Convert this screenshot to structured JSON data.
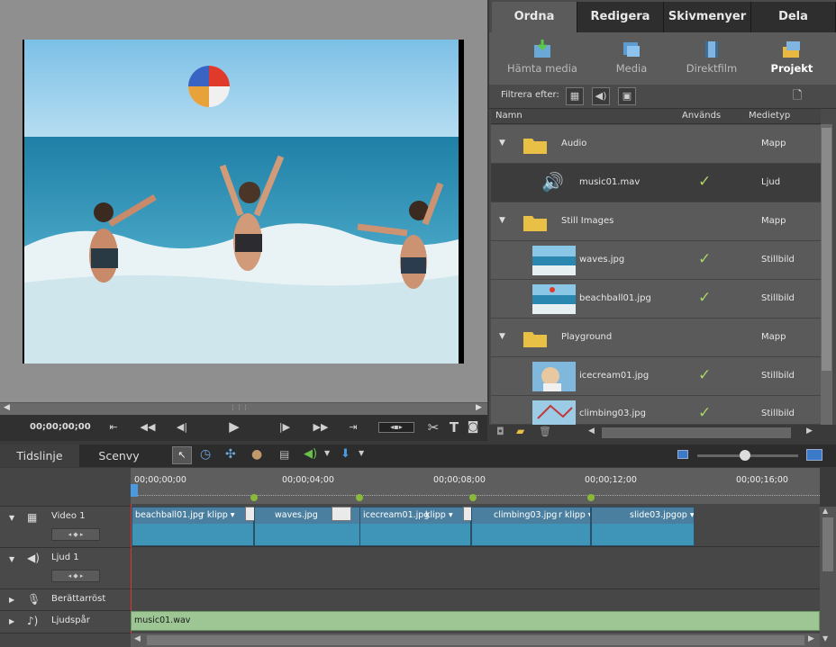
{
  "monitor": {
    "timecode": "00;00;00;00",
    "scroll_grip": "⋮⋮⋮"
  },
  "tabs": [
    "Ordna",
    "Redigera",
    "Skivmenyer",
    "Dela"
  ],
  "subtabs": [
    "Hämta media",
    "Media",
    "Direktfilm",
    "Projekt"
  ],
  "filter_label": "Filtrera efter:",
  "columns": {
    "name": "Namn",
    "used": "Används",
    "type": "Medietyp"
  },
  "rows": [
    {
      "name": "Audio",
      "type": "Mapp",
      "kind": "folder",
      "used": ""
    },
    {
      "name": "music01.mav",
      "type": "Ljud",
      "kind": "audio",
      "used": "✓"
    },
    {
      "name": "Still Images",
      "type": "Mapp",
      "kind": "folder",
      "used": ""
    },
    {
      "name": "waves.jpg",
      "type": "Stillbild",
      "kind": "image",
      "used": "✓"
    },
    {
      "name": "beachball01.jpg",
      "type": "Stillbild",
      "kind": "image",
      "used": "✓"
    },
    {
      "name": "Playground",
      "type": "Mapp",
      "kind": "folder",
      "used": ""
    },
    {
      "name": "icecream01.jpg",
      "type": "Stillbild",
      "kind": "image",
      "used": "✓"
    },
    {
      "name": "climbing03.jpg",
      "type": "Stillbild",
      "kind": "image",
      "used": "✓"
    }
  ],
  "timeline": {
    "tabs": [
      "Tidslinje",
      "Scenvy"
    ],
    "ruler": [
      "00;00;00;00",
      "00;00;04;00",
      "00;00;08;00",
      "00;00;12;00",
      "00;00;16;00"
    ],
    "tracks": [
      "Video 1",
      "Ljud 1",
      "Berättarröst",
      "Ljudspår"
    ],
    "clips": [
      {
        "name": "beachball01.jpg",
        "tag": "r klipp ▾"
      },
      {
        "name": "waves.jpg",
        "tag": ""
      },
      {
        "name": "icecream01.jpg",
        "tag": "klipp ▾"
      },
      {
        "name": "climbing03.jpg",
        "tag": "r klipp ▾"
      },
      {
        "name": "slide03.jpg",
        "tag": "op ▾"
      }
    ],
    "audio_clip": "music01.wav"
  }
}
